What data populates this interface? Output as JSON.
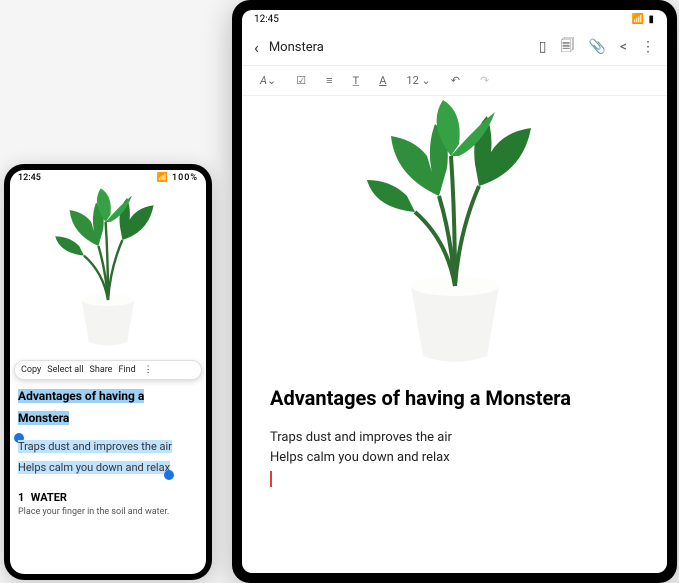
{
  "phone": {
    "status": {
      "time": "12:45",
      "right": "📶 100%"
    },
    "context_menu": {
      "copy": "Copy",
      "select_all": "Select all",
      "share": "Share",
      "find": "Find"
    },
    "heading": "Advantages of having a Monstera",
    "body_line1": "Traps dust and improves the air",
    "body_line2": "Helps calm you down and relax",
    "section": {
      "num": "1",
      "title": "WATER",
      "body": "Place your finger in the soil and water."
    }
  },
  "tablet": {
    "status": {
      "time": "12:45",
      "right": "📶 ▮"
    },
    "title": "Monstera",
    "toolbar": {
      "font_size": "12"
    },
    "heading": "Advantages of having a Monstera",
    "body_line1": "Traps dust and improves the air",
    "body_line2": "Helps calm you down and relax"
  }
}
